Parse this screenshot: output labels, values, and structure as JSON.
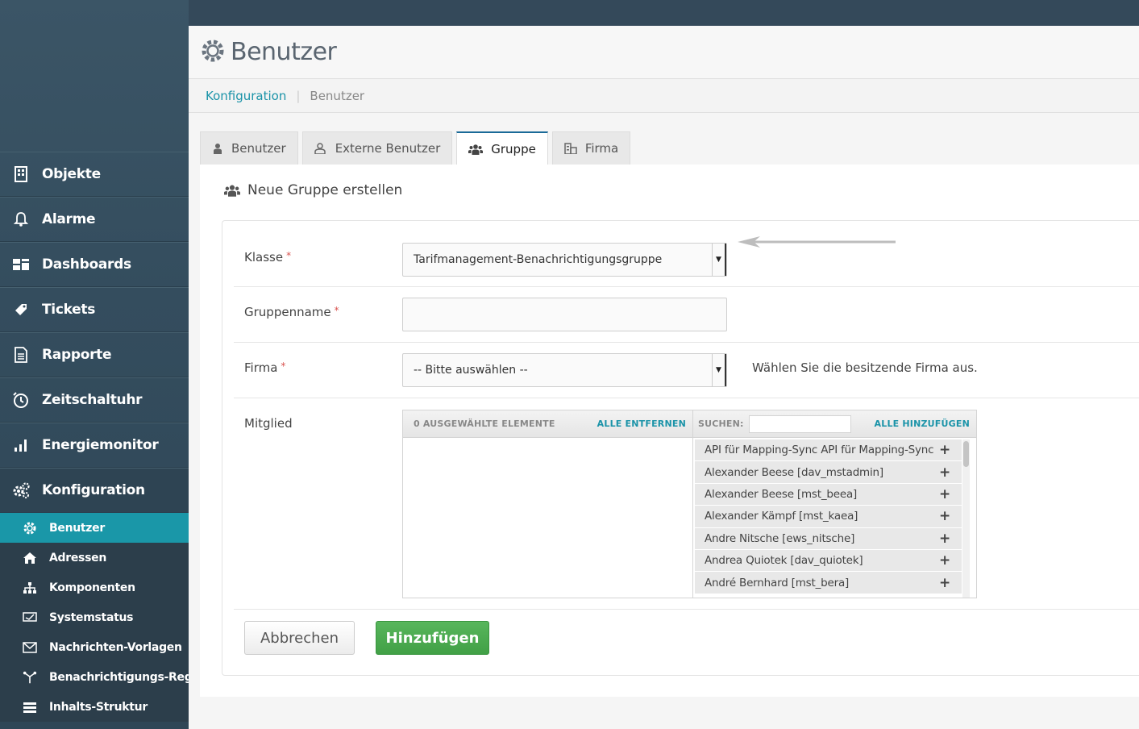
{
  "sidebar": {
    "items": [
      {
        "label": "Objekte",
        "icon": "building-icon"
      },
      {
        "label": "Alarme",
        "icon": "bell-icon"
      },
      {
        "label": "Dashboards",
        "icon": "dashboard-icon"
      },
      {
        "label": "Tickets",
        "icon": "ticket-icon"
      },
      {
        "label": "Rapporte",
        "icon": "document-icon"
      },
      {
        "label": "Zeitschaltuhr",
        "icon": "clock-icon"
      },
      {
        "label": "Energiemonitor",
        "icon": "bar-chart-icon"
      },
      {
        "label": "Konfiguration",
        "icon": "gears-icon"
      }
    ],
    "subitems": [
      {
        "label": "Benutzer",
        "icon": "gear-icon"
      },
      {
        "label": "Adressen",
        "icon": "home-icon"
      },
      {
        "label": "Komponenten",
        "icon": "sitemap-icon"
      },
      {
        "label": "Systemstatus",
        "icon": "status-icon"
      },
      {
        "label": "Nachrichten-Vorlagen",
        "icon": "envelope-icon"
      },
      {
        "label": "Benachrichtigungs-Regeln",
        "icon": "fork-icon"
      },
      {
        "label": "Inhalts-Struktur",
        "icon": "list-icon"
      }
    ]
  },
  "header": {
    "title": "Benutzer"
  },
  "breadcrumb": {
    "root": "Konfiguration",
    "current": "Benutzer"
  },
  "tabs": [
    {
      "label": "Benutzer"
    },
    {
      "label": "Externe Benutzer"
    },
    {
      "label": "Gruppe"
    },
    {
      "label": "Firma"
    }
  ],
  "panel": {
    "title": "Neue Gruppe erstellen"
  },
  "form": {
    "klasse_label": "Klasse",
    "klasse_value": "Tarifmanagement-Benachrichtigungsgruppe",
    "gruppenname_label": "Gruppenname",
    "gruppenname_value": "",
    "firma_label": "Firma",
    "firma_value": "-- Bitte auswählen --",
    "firma_help": "Wählen Sie die besitzende Firma aus.",
    "mitglied_label": "Mitglied",
    "required_mark": "*"
  },
  "multiselect": {
    "selected_count": "0 AUSGEWÄHLTE ELEMENTE",
    "remove_all": "ALLE ENTFERNEN",
    "search_label": "SUCHEN:",
    "add_all": "ALLE HINZUFÜGEN",
    "available": [
      "API für Mapping-Sync API für Mapping-Sync",
      "Alexander Beese [dav_mstadmin]",
      "Alexander Beese [mst_beea]",
      "Alexander Kämpf [mst_kaea]",
      "Andre Nitsche [ews_nitsche]",
      "Andrea Quiotek [dav_quiotek]",
      "André Bernhard [mst_bera]"
    ],
    "add_symbol": "+"
  },
  "buttons": {
    "cancel": "Abbrechen",
    "add": "Hinzufügen"
  },
  "colors": {
    "accent": "#1a97a8",
    "primary_button": "#4cab51",
    "sidebar": "#34495a"
  }
}
